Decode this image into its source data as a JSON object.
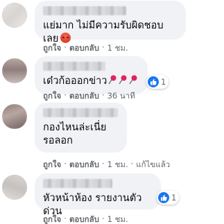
{
  "colors": {
    "bubble": "#f0f2f5",
    "meta_text": "#65676b",
    "like_blue": "#1877f2",
    "angry_red": "#e23a2f",
    "pin_red": "#e0245e"
  },
  "comments": [
    {
      "text": "แย่มาก ไม่มีความรับผิดชอบเลย",
      "emoji": "angry-face-icon",
      "actions": {
        "like": "ถูกใจ",
        "reply": "ตอบกลับ",
        "time": "1 ชม."
      }
    },
    {
      "text": "เด๋วก้อออกข่าว",
      "emoji": "pushpin-icon",
      "reaction_count": "1",
      "actions": {
        "like": "ถูกใจ",
        "reply": "ตอบกลับ",
        "time": "36 นาที"
      }
    },
    {
      "text": "กองไหนล่ะเนี่ย\nรอลอก",
      "actions": {
        "like": "ถูกใจ",
        "reply": "ตอบกลับ",
        "time": "1 ชม.",
        "edited": "แก้ไขแล้ว"
      }
    },
    {
      "text": "หัวหน้าห้อง รายงานตัวด่วน",
      "reaction_count": "1",
      "actions": {
        "like": "ถูกใจ",
        "reply": "ตอบกลับ",
        "time": "1 ชม."
      }
    }
  ],
  "separator": "·"
}
